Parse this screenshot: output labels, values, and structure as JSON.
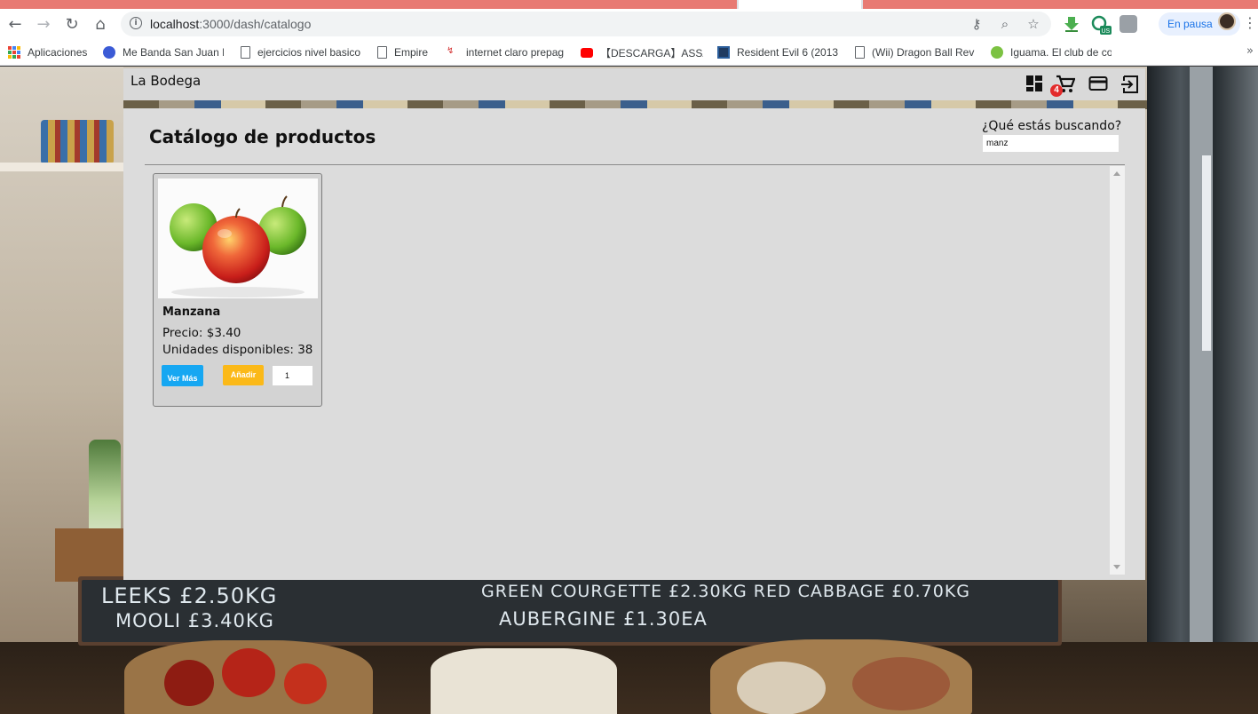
{
  "browser": {
    "url_host": "localhost",
    "url_path": ":3000/dash/catalogo",
    "profile_status": "En pausa",
    "bookmarks": [
      {
        "label": "Aplicaciones",
        "icon": "apps-grid-icon"
      },
      {
        "label": "Me Banda San Juan M",
        "icon": "music-icon"
      },
      {
        "label": "ejercicios nivel basico",
        "icon": "page-icon"
      },
      {
        "label": "Empire",
        "icon": "page-icon"
      },
      {
        "label": "internet claro prepag",
        "icon": "claro-icon"
      },
      {
        "label": "【DESCARGA】ASSASS",
        "icon": "youtube-icon"
      },
      {
        "label": "Resident Evil 6 (2013)",
        "icon": "game-icon"
      },
      {
        "label": "(Wii) Dragon Ball Rev",
        "icon": "page-icon"
      },
      {
        "label": "Iguama. El club de co",
        "icon": "iguama-icon"
      }
    ]
  },
  "app": {
    "brand": "La Bodega",
    "nav_icons": [
      "dashboard-icon",
      "cart-icon",
      "card-icon",
      "logout-icon"
    ],
    "cart_count": "4",
    "page_title": "Catálogo de productos",
    "search": {
      "label": "¿Qué estás buscando?",
      "value": "manz"
    },
    "products": [
      {
        "name": "Manzana",
        "price_text": "Precio: $3.40",
        "stock_text": "Unidades disponibles: 38",
        "view_label": "Ver Más",
        "add_label": "Añadir",
        "quantity": "1"
      }
    ]
  },
  "background": {
    "board_line_1_left": "LEEKS £2.50KG",
    "board_line_2_left": "MOOLI £3.40KG",
    "board_line_1_right": "GREEN COURGETTE £2.30KG   RED CABBAGE £0.70KG",
    "board_line_2_right": "AUBERGINE £1.30EA"
  },
  "colors": {
    "view_button": "#16a7f2",
    "add_button": "#fbb918",
    "badge": "#e32b2b",
    "panel": "#dcdcdc"
  }
}
